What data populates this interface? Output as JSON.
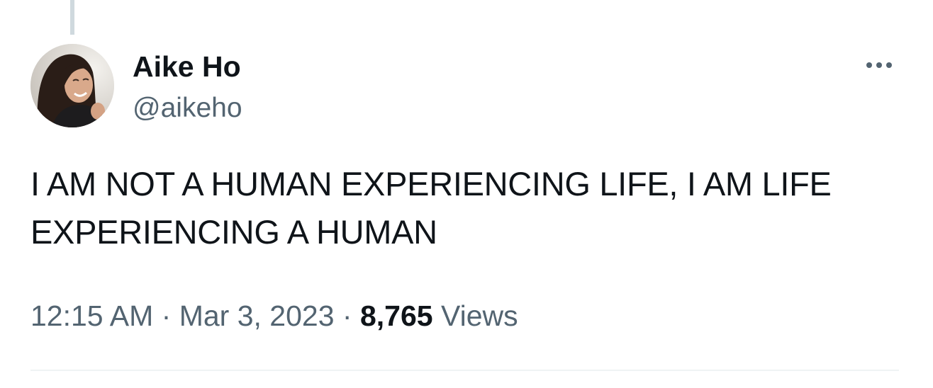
{
  "author": {
    "display_name": "Aike Ho",
    "handle": "@aikeho"
  },
  "tweet": {
    "text": "I AM NOT A HUMAN EXPERIENCING LIFE, I AM LIFE EXPERIENCING A HUMAN",
    "time": "12:15 AM",
    "separator": "·",
    "date": "Mar 3, 2023",
    "views_count": "8,765",
    "views_label": "Views"
  },
  "icons": {
    "more": "more-horizontal-icon",
    "avatar": "avatar"
  },
  "colors": {
    "text_primary": "#0f1419",
    "text_secondary": "#536471",
    "thread_line": "#cfd9de",
    "divider": "#eff3f4",
    "background": "#ffffff"
  }
}
